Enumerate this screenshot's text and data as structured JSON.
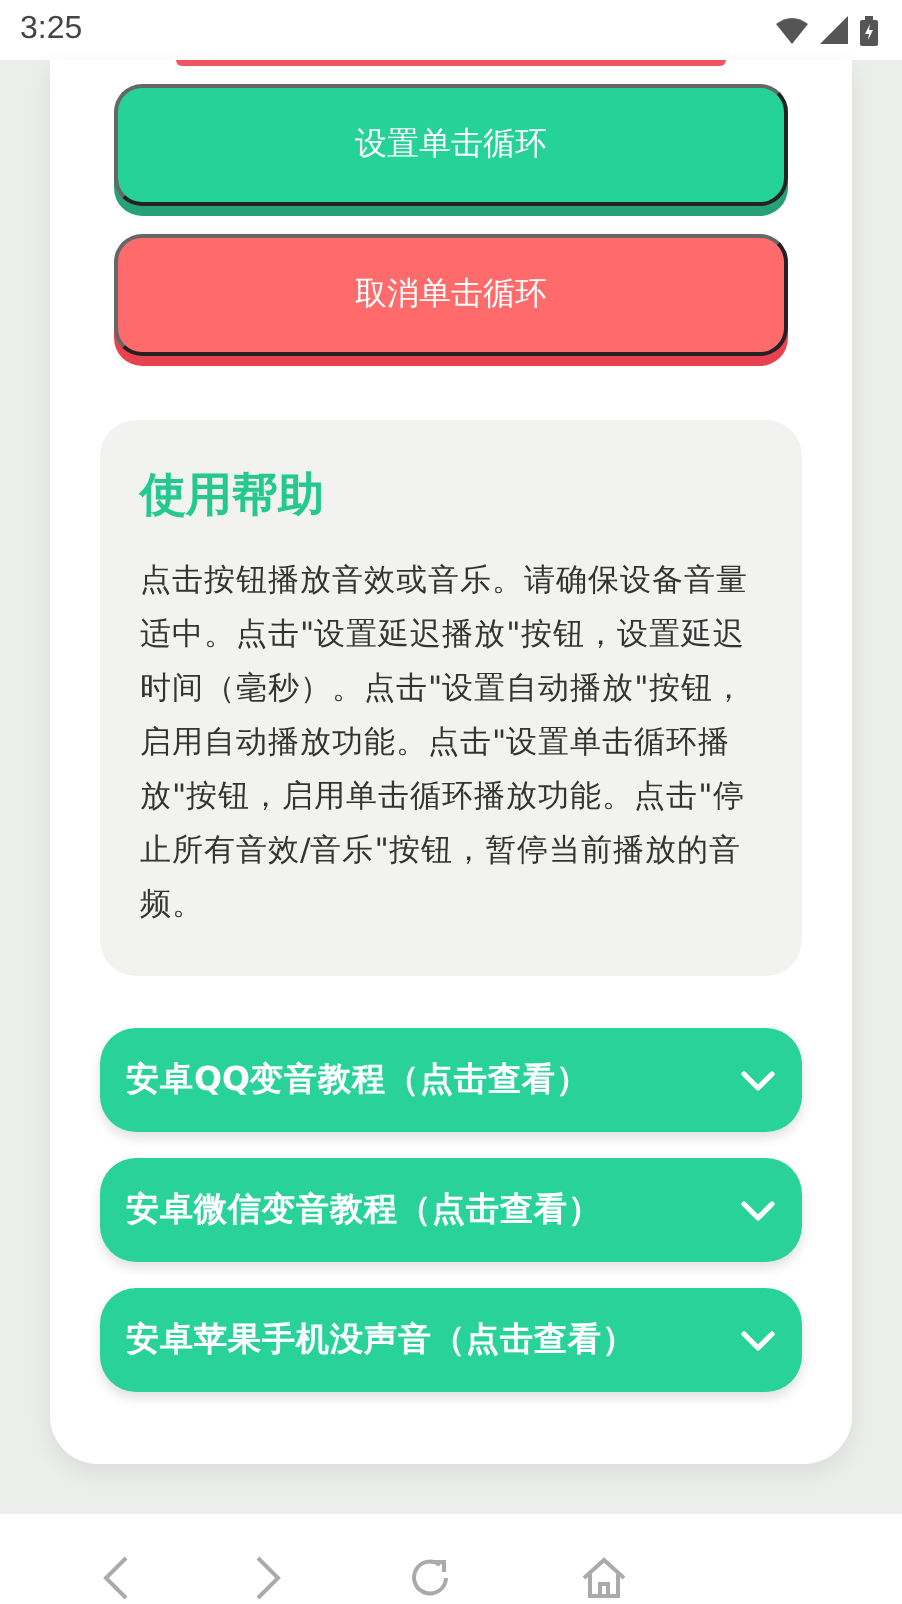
{
  "status_bar": {
    "time": "3:25"
  },
  "buttons": [
    {
      "label": "设置单击循环",
      "kind": "primary"
    },
    {
      "label": "取消单击循环",
      "kind": "danger"
    }
  ],
  "help": {
    "title": "使用帮助",
    "body": "点击按钮播放音效或音乐。请确保设备音量适中。点击\"设置延迟播放\"按钮，设置延迟时间（毫秒）。点击\"设置自动播放\"按钮，启用自动播放功能。点击\"设置单击循环播放\"按钮，启用单击循环播放功能。点击\"停止所有音效/音乐\"按钮，暂停当前播放的音频。"
  },
  "accordions": [
    {
      "label": "安卓QQ变音教程（点击查看）",
      "expanded": false
    },
    {
      "label": "安卓微信变音教程（点击查看）",
      "expanded": false
    },
    {
      "label": "安卓苹果手机没声音（点击查看）",
      "expanded": false
    }
  ]
}
